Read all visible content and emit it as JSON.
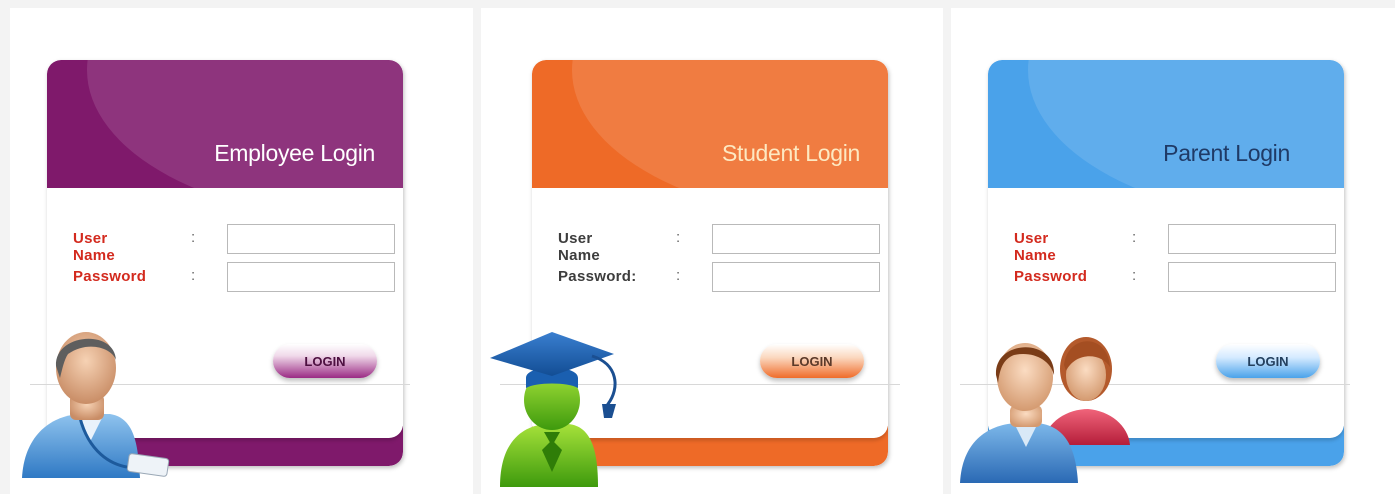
{
  "panels": [
    {
      "title": "Employee Login",
      "username_label": "User Name",
      "username_colon": ":",
      "password_label": "Password",
      "password_colon": ":",
      "username_value": "",
      "password_value": "",
      "button_label": "LOGIN",
      "color": "#7f196b",
      "icon": "employee-avatar-icon"
    },
    {
      "title": "Student Login",
      "username_label": "User Name",
      "username_colon": ":",
      "password_label": "Password:",
      "password_colon": ":",
      "username_value": "",
      "password_value": "",
      "button_label": "LOGIN",
      "color": "#ee6a27",
      "icon": "graduate-avatar-icon"
    },
    {
      "title": "Parent Login",
      "username_label": "User Name",
      "username_colon": ":",
      "password_label": "Password",
      "password_colon": ":",
      "username_value": "",
      "password_value": "",
      "button_label": "LOGIN",
      "color": "#4aa2ea",
      "icon": "parents-avatar-icon"
    }
  ]
}
